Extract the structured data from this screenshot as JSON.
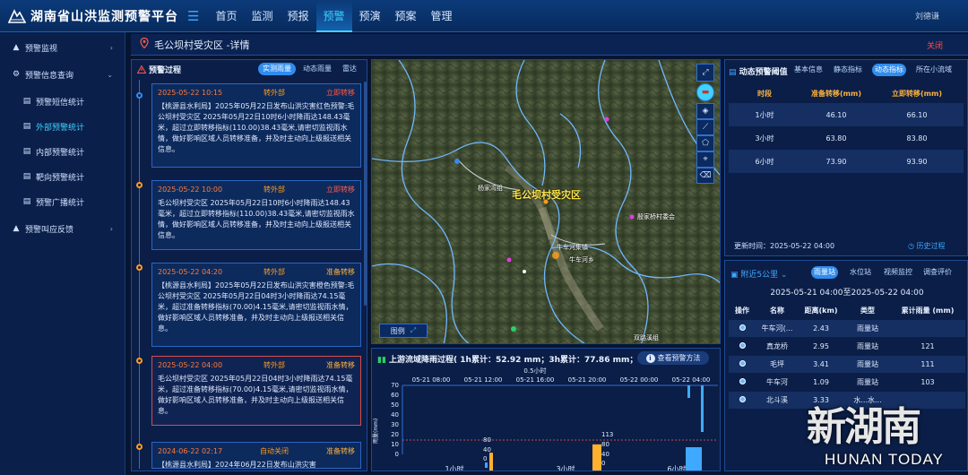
{
  "app": {
    "title": "湖南省山洪监测预警平台",
    "user": "刘德谦"
  },
  "nav": [
    "首页",
    "监测",
    "预报",
    "预警",
    "预演",
    "预案",
    "管理"
  ],
  "nav_active": 3,
  "sidebar": [
    {
      "label": "预警监视",
      "icon": "bell-icon",
      "chevron": "›",
      "level": 0
    },
    {
      "label": "预警信息查询",
      "icon": "info-icon",
      "chevron": "⌄",
      "level": 0
    },
    {
      "label": "预警短信统计",
      "icon": "doc-icon",
      "level": 1
    },
    {
      "label": "外部预警统计",
      "icon": "doc-icon",
      "level": 1,
      "active": true
    },
    {
      "label": "内部预警统计",
      "icon": "doc-icon",
      "level": 1
    },
    {
      "label": "靶向预警统计",
      "icon": "doc-icon",
      "level": 1
    },
    {
      "label": "预警广播统计",
      "icon": "doc-icon",
      "level": 1
    },
    {
      "label": "预警叫应反馈",
      "icon": "bell-icon",
      "chevron": "›",
      "level": 0
    }
  ],
  "detail": {
    "title": "毛公坝村受灾区 -详情",
    "close": "关闭"
  },
  "process": {
    "title": "预警过程",
    "tabs": [
      "实测雨量",
      "动态雨量",
      "雷达"
    ],
    "active_tab": 0,
    "cards": [
      {
        "date": "2025-05-22 10:15",
        "status": "转外部",
        "level": "立即转移",
        "level_class": "lvl-red",
        "style": "blue",
        "text": "【桃源县水利局】2025年05月22日发布山洪灾害红色预警:毛公坝村受灾区 2025年05月22日10时6小时降雨达148.43毫米，超过立即转移指标(110.00)38.43毫米,请密切监视雨水情，做好影响区域人员转移准备，并及时主动向上级报送相关信息。"
      },
      {
        "date": "2025-05-22 10:00",
        "status": "转外部",
        "level": "立即转移",
        "level_class": "lvl-red",
        "style": "blue",
        "text": "毛公坝村受灾区 2025年05月22日10时6小时降雨达148.43毫米，超过立即转移指标(110.00)38.43毫米,请密切监视雨水情，做好影响区域人员转移准备，并及时主动向上级报送相关信息。"
      },
      {
        "date": "2025-05-22 04:20",
        "status": "转外部",
        "level": "准备转移",
        "level_class": "lvl-or",
        "style": "blue",
        "text": "【桃源县水利局】2025年05月22日发布山洪灾害橙色预警:毛公坝村受灾区 2025年05月22日04时3小时降雨达74.15毫米，超过准备转移指标(70.00)4.15毫米,请密切监视雨水情，做好影响区域人员转移准备，并及时主动向上级报送相关信息。"
      },
      {
        "date": "2025-05-22 04:00",
        "status": "转外部",
        "level": "准备转移",
        "level_class": "lvl-or",
        "style": "red",
        "text": "毛公坝村受灾区 2025年05月22日04时3小时降雨达74.15毫米，超过准备转移指标(70.00)4.15毫米,请密切监视雨水情，做好影响区域人员转移准备，并及时主动向上级报送相关信息。"
      },
      {
        "date": "2024-06-22 02:17",
        "status": "自动关闭",
        "level": "准备转移",
        "level_class": "lvl-or",
        "style": "blue",
        "text": "【桃源县水利局】2024年06月22日发布山洪灾害"
      }
    ]
  },
  "map": {
    "main_label": "毛公坝村受灾区",
    "labels": [
      {
        "t": "杨家湾组"
      },
      {
        "t": "殷家桥村委会"
      },
      {
        "t": "牛车河集镇"
      },
      {
        "t": "牛车河乡"
      },
      {
        "t": "双路溪组"
      }
    ],
    "legend": "图例",
    "tools": [
      "fullscreen-icon",
      "briefcase-icon",
      "layers-icon",
      "ruler-icon",
      "polygon-icon",
      "measure-icon",
      "trash-icon"
    ]
  },
  "rain": {
    "title": "上游流域降雨过程( 1h累计：52.92 mm；3h累计：77.86 mm；6h累",
    "method": "查看预警方法",
    "axis_top_label": "0.5小时",
    "top_ticks": [
      "05-21 08:00",
      "05-21 12:00",
      "05-21 16:00",
      "05-21 20:00",
      "05-22 00:00",
      "05-22 04:00"
    ],
    "y_ticks": [
      "0",
      "10",
      "20",
      "30",
      "40",
      "50",
      "60",
      "70"
    ],
    "ylabel": "雨量(mm)",
    "groups": [
      "1小时",
      "3小时",
      "6小时"
    ],
    "threshold_labels": [
      "80",
      "40",
      "0",
      "113",
      "80",
      "40",
      "0"
    ]
  },
  "chart_data": {
    "type": "bar",
    "title": "上游流域降雨过程",
    "series": [
      {
        "name": "1h累计",
        "values": [
          52.92
        ]
      },
      {
        "name": "3h累计",
        "values": [
          77.86
        ]
      }
    ],
    "groups": [
      "1小时",
      "3小时",
      "6小时"
    ],
    "threshold_1h": [
      46.1,
      66.1
    ],
    "threshold_3h": [
      63.8,
      83.8
    ],
    "threshold_6h": [
      73.9,
      93.9
    ]
  },
  "threshold": {
    "title": "动态预警阈值",
    "tabs": [
      "基本信息",
      "静态指标",
      "动态指标",
      "所在小流域"
    ],
    "active_tab": 2,
    "headers": [
      "时段",
      "准备转移(mm)",
      "立即转移(mm)"
    ],
    "rows": [
      [
        "1小时",
        "46.10",
        "66.10"
      ],
      [
        "3小时",
        "63.80",
        "83.80"
      ],
      [
        "6小时",
        "73.90",
        "93.90"
      ]
    ],
    "update": "更新时间：2025-05-22 04:00",
    "history": "历史过程"
  },
  "nearby": {
    "title": "附近5公里",
    "tabs": [
      "雨量站",
      "水位站",
      "视频监控",
      "调查评价"
    ],
    "active_tab": 0,
    "range": "2025-05-21 04:00至2025-05-22 04:00",
    "headers": [
      "操作",
      "名称",
      "距离(km)",
      "类型",
      "累计雨量 (mm)"
    ],
    "rows": [
      [
        "牛车河(...",
        "2.43",
        "雨量站",
        ""
      ],
      [
        "真龙桥",
        "2.95",
        "雨量站",
        "121"
      ],
      [
        "毛坪",
        "3.41",
        "雨量站",
        "111"
      ],
      [
        "牛车河",
        "1.09",
        "雨量站",
        "103"
      ],
      [
        "北斗溪",
        "3.33",
        "水...水...",
        ""
      ]
    ]
  },
  "watermark": {
    "cn": "新湖南",
    "en": "HUNAN TODAY"
  }
}
